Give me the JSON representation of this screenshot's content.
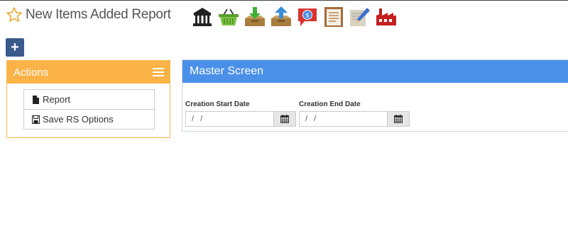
{
  "header": {
    "title": "New Items Added Report",
    "favorite_icon": "star-outline-icon"
  },
  "toolbar": {
    "icons": [
      "bank-icon",
      "basket-icon",
      "inbox-download-icon",
      "outbox-upload-icon",
      "coin-speech-bubble-icon",
      "notepad-icon",
      "pencil-edit-icon",
      "factory-icon"
    ]
  },
  "add_button": {
    "label": "+"
  },
  "actions": {
    "title": "Actions",
    "items": [
      {
        "label": "Report",
        "icon": "document-icon"
      },
      {
        "label": "Save RS Options",
        "icon": "floppy-disk-icon"
      }
    ]
  },
  "master": {
    "title": "Master Screen",
    "start_date": {
      "label": "Creation Start Date",
      "value": "/ /"
    },
    "end_date": {
      "label": "Creation End Date",
      "value": "/ /"
    }
  },
  "colors": {
    "actions_header": "#fbb347",
    "master_header": "#4a90e8",
    "add_button": "#3a5a8c",
    "star": "#f0a830"
  }
}
